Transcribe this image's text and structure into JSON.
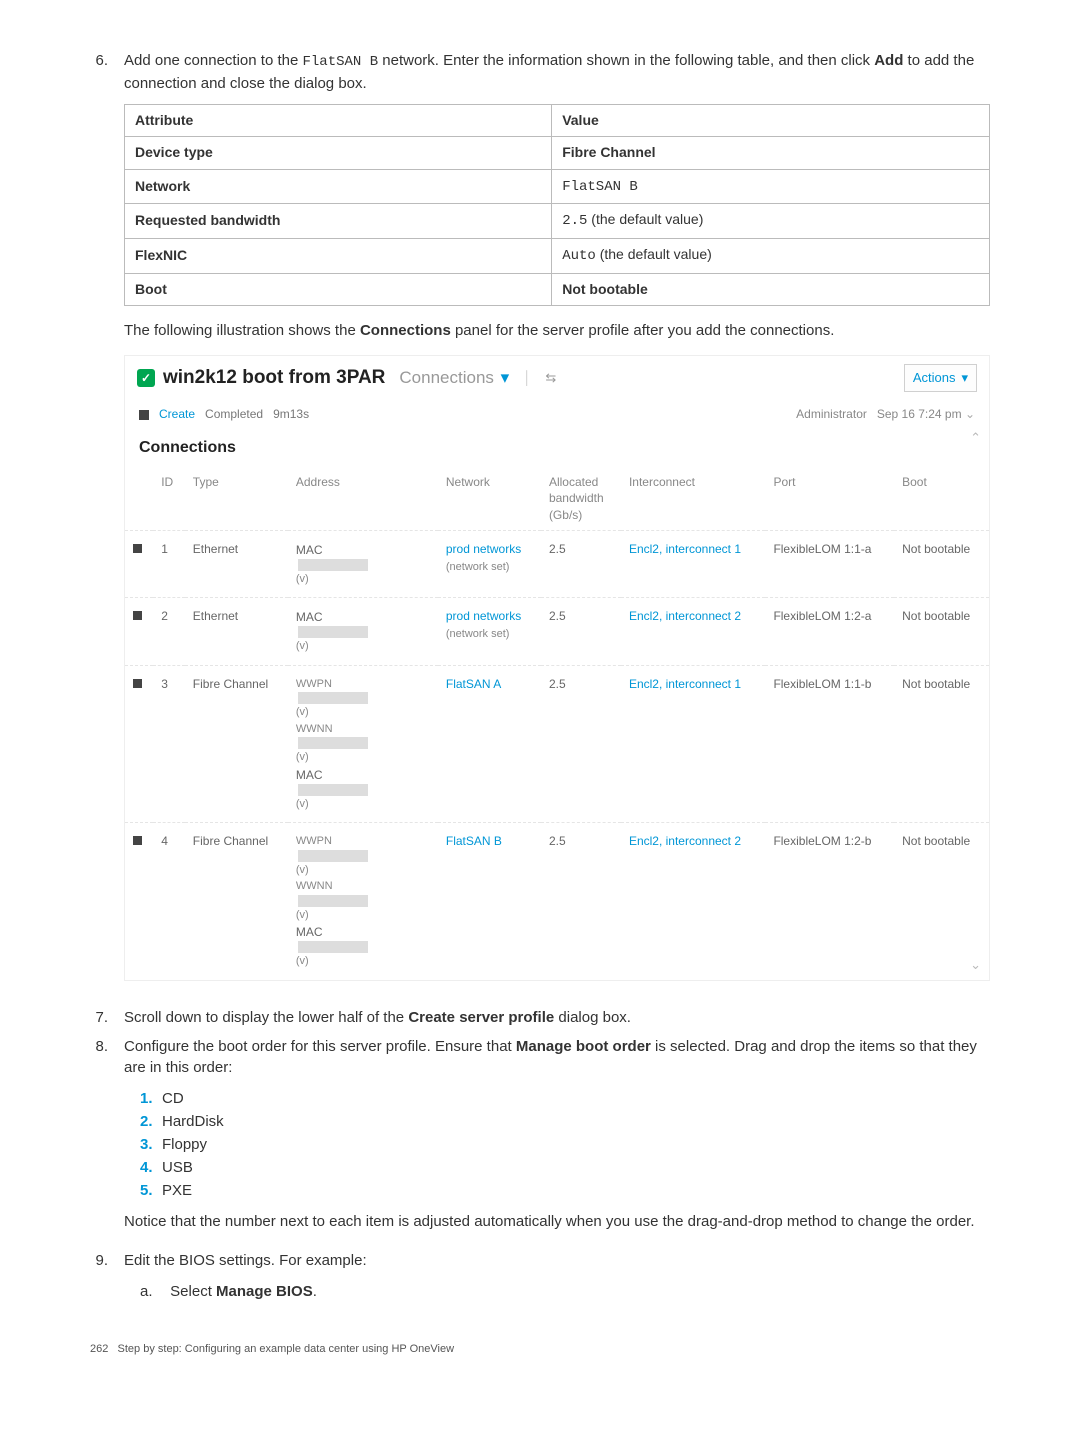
{
  "step6": {
    "num": "6.",
    "text_before": "Add one connection to the ",
    "code": "FlatSAN B",
    "text_mid": " network. Enter the information shown in the following table, and then click ",
    "bold": "Add",
    "text_after": " to add the connection and close the dialog box."
  },
  "attr_table": {
    "headers": [
      "Attribute",
      "Value"
    ],
    "rows": [
      {
        "attr": "Device type",
        "attr_bold": true,
        "val": "Fibre Channel",
        "val_bold": true
      },
      {
        "attr": "Network",
        "attr_bold": true,
        "val_code": "FlatSAN B"
      },
      {
        "attr": "Requested bandwidth",
        "attr_bold": true,
        "val_code": "2.5",
        "val_suffix": " (the default value)"
      },
      {
        "attr": "FlexNIC",
        "attr_bold": true,
        "val_code": "Auto",
        "val_suffix": " (the default value)"
      },
      {
        "attr": "Boot",
        "attr_bold": true,
        "val": "Not bootable",
        "val_bold": true
      }
    ]
  },
  "para_after_table_a": "The following illustration shows the ",
  "para_after_table_bold": "Connections",
  "para_after_table_b": " panel for the server profile after you add the connections.",
  "panel": {
    "title": "win2k12 boot from 3PAR",
    "subtitle": "Connections",
    "actions": "Actions",
    "status_create": "Create",
    "status_completed": "Completed",
    "status_time": "9m13s",
    "status_user": "Administrator",
    "status_ts": "Sep 16 7:24 pm",
    "section_title": "Connections",
    "cols": {
      "id": "ID",
      "type": "Type",
      "address": "Address",
      "network": "Network",
      "alloc": "Allocated bandwidth (Gb/s)",
      "inter": "Interconnect",
      "port": "Port",
      "boot": "Boot"
    },
    "rows": [
      {
        "id": "1",
        "type": "Ethernet",
        "addr_lines": [
          {
            "l": "MAC",
            "red": true
          },
          {
            "l": "(v)"
          }
        ],
        "network": "prod networks",
        "net_sub": "(network set)",
        "alloc": "2.5",
        "inter": "Encl2, interconnect 1",
        "port": "FlexibleLOM 1:1-a",
        "boot": "Not bootable"
      },
      {
        "id": "2",
        "type": "Ethernet",
        "addr_lines": [
          {
            "l": "MAC",
            "red": true
          },
          {
            "l": "(v)"
          }
        ],
        "network": "prod networks",
        "net_sub": "(network set)",
        "alloc": "2.5",
        "inter": "Encl2, interconnect 2",
        "port": "FlexibleLOM 1:2-a",
        "boot": "Not bootable"
      },
      {
        "id": "3",
        "type": "Fibre Channel",
        "addr_lines": [
          {
            "l": "WWPN"
          },
          {
            "red": true
          },
          {
            "l": "(v)"
          },
          {
            "l": "WWNN"
          },
          {
            "red": true
          },
          {
            "l": "(v)"
          },
          {
            "l": "MAC",
            "red": true
          },
          {
            "l": "(v)"
          }
        ],
        "network": "FlatSAN A",
        "net_sub": "",
        "alloc": "2.5",
        "inter": "Encl2, interconnect 1",
        "port": "FlexibleLOM 1:1-b",
        "boot": "Not bootable"
      },
      {
        "id": "4",
        "type": "Fibre Channel",
        "addr_lines": [
          {
            "l": "WWPN"
          },
          {
            "red": true
          },
          {
            "l": "(v)"
          },
          {
            "l": "WWNN"
          },
          {
            "red": true
          },
          {
            "l": "(v)"
          },
          {
            "l": "MAC",
            "red": true
          },
          {
            "l": "(v)"
          }
        ],
        "network": "FlatSAN B",
        "net_sub": "",
        "alloc": "2.5",
        "inter": "Encl2, interconnect 2",
        "port": "FlexibleLOM 1:2-b",
        "boot": "Not bootable"
      }
    ]
  },
  "step7": {
    "num": "7.",
    "a": "Scroll down to display the lower half of the ",
    "b": "Create server profile",
    "c": " dialog box."
  },
  "step8": {
    "num": "8.",
    "a": "Configure the boot order for this server profile. Ensure that ",
    "b": "Manage boot order",
    "c": " is selected. Drag and drop the items so that they are in this order:"
  },
  "boot_order": [
    {
      "n": "1.",
      "t": "CD"
    },
    {
      "n": "2.",
      "t": "HardDisk"
    },
    {
      "n": "3.",
      "t": "Floppy"
    },
    {
      "n": "4.",
      "t": "USB"
    },
    {
      "n": "5.",
      "t": "PXE"
    }
  ],
  "boot_note": "Notice that the number next to each item is adjusted automatically when you use the drag-and-drop method to change the order.",
  "step9": {
    "num": "9.",
    "text": "Edit the BIOS settings. For example:"
  },
  "step9a": {
    "letter": "a.",
    "a": "Select ",
    "b": "Manage BIOS",
    "c": "."
  },
  "footer": {
    "page": "262",
    "title": "Step by step: Configuring an example data center using HP OneView"
  }
}
